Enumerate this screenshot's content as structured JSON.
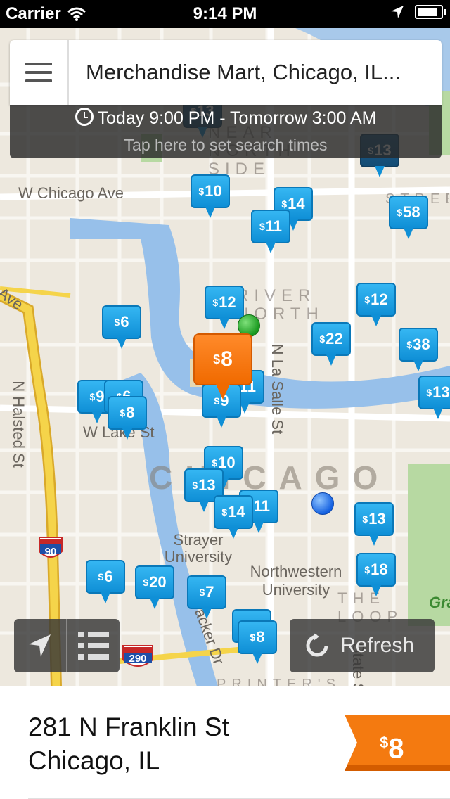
{
  "status_bar": {
    "carrier": "Carrier",
    "time": "9:14 PM"
  },
  "search": {
    "location": "Merchandise Mart, Chicago, IL...",
    "time_range": "Today 9:00 PM - Tomorrow 3:00 AM",
    "hint": "Tap here to set search times"
  },
  "map": {
    "streets": [
      "W Chicago Ave",
      "N Halsted St",
      "W Lake St",
      "N La Salle St",
      "Ave",
      "acker Dr",
      "State St"
    ],
    "districts": [
      "CHICAGO",
      "RIVER NORTH",
      "NEAR NORTH SIDE",
      "THE LOOP",
      "PRINTER'S ROW",
      "STREETERVILLE"
    ],
    "places": [
      "Strayer University",
      "Northwestern University",
      "Gra"
    ],
    "highways": [
      "90",
      "290"
    ]
  },
  "pins": [
    {
      "label": "13",
      "dark": true
    },
    {
      "label": "10"
    },
    {
      "label": "14"
    },
    {
      "label": "11"
    },
    {
      "label": "58"
    },
    {
      "label": "12"
    },
    {
      "label": "12"
    },
    {
      "label": "6"
    },
    {
      "label": "22"
    },
    {
      "label": "38"
    },
    {
      "label": "9"
    },
    {
      "label": "6"
    },
    {
      "label": "8"
    },
    {
      "label": "9"
    },
    {
      "label": "11"
    },
    {
      "label": "13"
    },
    {
      "label": "10"
    },
    {
      "label": "13"
    },
    {
      "label": "14"
    },
    {
      "label": "11"
    },
    {
      "label": "13"
    },
    {
      "label": "6"
    },
    {
      "label": "20"
    },
    {
      "label": "7"
    },
    {
      "label": "18"
    },
    {
      "label": "8"
    },
    {
      "label": "8"
    }
  ],
  "selected_pin": {
    "label": "8"
  },
  "controls": {
    "refresh_label": "Refresh"
  },
  "selected_lot": {
    "address_line1": "281 N Franklin St",
    "address_line2": "Chicago, IL",
    "price": "8"
  },
  "colors": {
    "pin_blue": "#1ea3e6",
    "selected_orange": "#f47a10",
    "highway_yellow": "#f5d44a"
  }
}
